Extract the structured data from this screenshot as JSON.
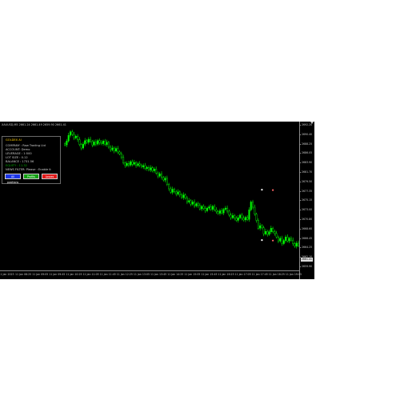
{
  "chart": {
    "symbol_header": "XAUUSD,M5  2661.24 2661.49 2659.90 2661.41",
    "colors": {
      "background": "#000000",
      "bull_candle": "#00ff00",
      "bear_candle": "#000000",
      "candle_outline": "#00ff00",
      "axis_text": "#c8c8c8"
    },
    "price_labels": [
      "2692.20",
      "2690.40",
      "2688.25",
      "2686.05",
      "2683.90",
      "2681.70",
      "2679.50",
      "2677.35",
      "2675.15",
      "2673.00",
      "2670.80",
      "2668.60",
      "2666.45",
      "2664.25",
      "2662.10",
      "2659.90"
    ],
    "current_price": "2661.41",
    "time_labels": [
      "11 Jan 2023",
      "11 Jan 08:25",
      "11 Jan 09:05",
      "11 Jan 09:45",
      "11 Jan 10:25",
      "11 Jan 11:05",
      "11 Jan 11:45",
      "11 Jan 12:25",
      "11 Jan 13:05",
      "11 Jan 13:45",
      "11 Jan 14:25",
      "11 Jan 15:05",
      "11 Jan 15:45",
      "11 Jan 16:25",
      "11 Jan 17:05",
      "11 Jan 17:45",
      "11 Jan 18:25",
      "11 Jan 19:05"
    ],
    "trade_markers": [
      {
        "type": "buy",
        "color": "#ffffff"
      },
      {
        "type": "sell",
        "color": "#ff6666"
      },
      {
        "type": "buy",
        "color": "#ffffff"
      },
      {
        "type": "sell",
        "color": "#ff6666"
      }
    ]
  },
  "chart_data": {
    "type": "candlestick",
    "ylim": [
      2659.9,
      2692.2
    ],
    "closes": [
      2687.6,
      2688.5,
      2689.8,
      2690.6,
      2690.0,
      2689.2,
      2689.6,
      2688.8,
      2687.7,
      2686.9,
      2687.8,
      2688.6,
      2688.2,
      2688.9,
      2688.4,
      2687.6,
      2688.3,
      2687.8,
      2688.6,
      2688.1,
      2687.9,
      2688.5,
      2687.7,
      2688.2,
      2687.1,
      2686.5,
      2686.9,
      2686.2,
      2686.8,
      2686.0,
      2685.6,
      2684.8,
      2683.5,
      2682.9,
      2683.4,
      2683.0,
      2683.8,
      2683.2,
      2683.6,
      2682.9,
      2683.3,
      2683.0,
      2682.6,
      2682.9,
      2682.2,
      2682.5,
      2681.9,
      2682.4,
      2681.7,
      2682.1,
      2681.2,
      2680.5,
      2681.0,
      2680.2,
      2679.6,
      2680.0,
      2678.6,
      2677.6,
      2676.8,
      2677.5,
      2676.9,
      2676.4,
      2676.9,
      2676.2,
      2675.6,
      2676.2,
      2675.5,
      2674.6,
      2674.9,
      2674.1,
      2674.6,
      2673.7,
      2674.2,
      2673.8,
      2673.0,
      2673.6,
      2673.1,
      2672.6,
      2673.2,
      2673.5,
      2672.9,
      2673.6,
      2672.8,
      2672.4,
      2672.0,
      2672.6,
      2672.1,
      2672.9,
      2673.2,
      2672.5,
      2671.6,
      2671.0,
      2671.5,
      2670.9,
      2670.4,
      2671.0,
      2671.6,
      2670.9,
      2670.5,
      2671.1,
      2670.6,
      2672.8,
      2674.6,
      2673.4,
      2671.8,
      2670.4,
      2668.6,
      2669.2,
      2668.7,
      2667.3,
      2667.9,
      2667.2,
      2667.8,
      2668.6,
      2667.8,
      2667.4,
      2666.6,
      2665.7,
      2666.3,
      2665.1,
      2665.8,
      2666.6,
      2665.7,
      2666.3,
      2665.9,
      2665.1,
      2664.5,
      2665.2,
      2664.6,
      2663.8,
      2662.8,
      2661.4
    ],
    "marker_prices": [
      2677.4,
      2677.3,
      2665.9,
      2665.8
    ]
  },
  "panel": {
    "title": "GOLDEX AI",
    "company": "COMPANY : Raw Trading Ltd",
    "account": "ACCOUNT: Demo",
    "leverage": "LEVERAGE : 1:500",
    "lot_size": "LOT SIZE : 0.12",
    "balance": "BALANCE : 1731.56",
    "equity": "EQUITY : 11.32",
    "news_filter": "NEWS FILTER: Please : Enable it",
    "btn_blue": "All positions",
    "btn_green": "Profits",
    "btn_red": "Losses"
  }
}
